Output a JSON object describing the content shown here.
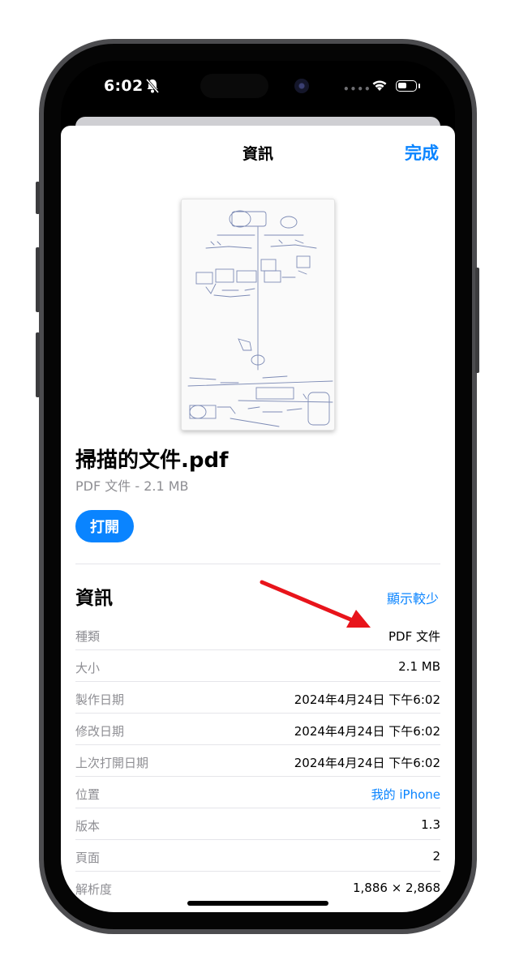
{
  "status_bar": {
    "time": "6:02",
    "signal_dots": "••••"
  },
  "sheet": {
    "title": "資訊",
    "done_label": "完成"
  },
  "file": {
    "name": "掃描的文件.pdf",
    "subtitle": "PDF 文件 - 2.1 MB",
    "open_label": "打開"
  },
  "info": {
    "section_title": "資訊",
    "show_less_label": "顯示較少",
    "rows": [
      {
        "key": "種類",
        "value": "PDF 文件"
      },
      {
        "key": "大小",
        "value": "2.1 MB"
      },
      {
        "key": "製作日期",
        "value": "2024年4月24日 下午6:02"
      },
      {
        "key": "修改日期",
        "value": "2024年4月24日 下午6:02"
      },
      {
        "key": "上次打開日期",
        "value": "2024年4月24日 下午6:02"
      },
      {
        "key": "位置",
        "value": "我的 iPhone"
      },
      {
        "key": "版本",
        "value": "1.3"
      },
      {
        "key": "頁面",
        "value": "2"
      },
      {
        "key": "解析度",
        "value": "1,886 × 2,868"
      }
    ]
  },
  "colors": {
    "accent": "#0a84ff",
    "annotation_arrow": "#e8141b"
  }
}
